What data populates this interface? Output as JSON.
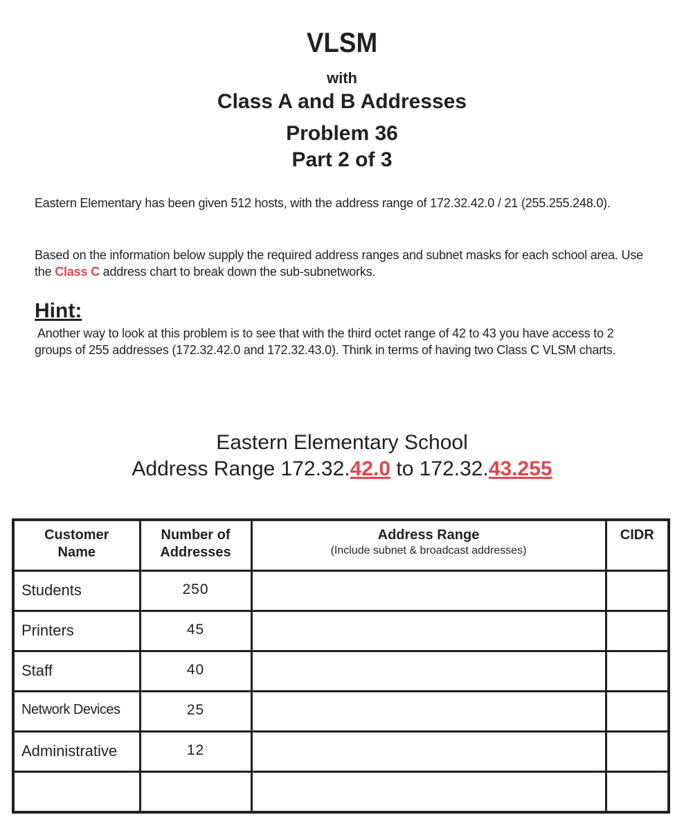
{
  "header": {
    "title": "VLSM",
    "with": "with",
    "subtitle": "Class A and B Addresses",
    "problem": "Problem 36",
    "part": "Part 2 of 3"
  },
  "intro": {
    "p1": "Eastern Elementary has been given 512 hosts, with the address range of 172.32.42.0 / 21 (255.255.248.0).",
    "p2_before": "Based on the information below supply the required address ranges and subnet masks for each school area.  Use the ",
    "p2_highlight": "Class C",
    "p2_after": " address chart to break down the sub-subnetworks.",
    "highlight_color": "#e1474d"
  },
  "hint": {
    "label": "Hint:",
    "text": "Another way to look at this problem is to see that with the third octet range of 42 to 43 you have access to 2 groups of 255 addresses (172.32.42.0 and 172.32.43.0).  Think in terms of having two Class C  VLSM charts."
  },
  "school": {
    "name": "Eastern Elementary School",
    "range_prefix": "Address Range 172.32.",
    "range_start": "42.0",
    "range_mid": " to 172.32.",
    "range_end": "43.255"
  },
  "table": {
    "headers": {
      "customer": "Customer Name",
      "number": "Number of Addresses",
      "range": "Address Range",
      "range_note": "(Include subnet & broadcast addresses)",
      "cidr": "CIDR"
    },
    "rows": [
      {
        "name": "Students",
        "count": "250",
        "range": "",
        "cidr": ""
      },
      {
        "name": "Printers",
        "count": "45",
        "range": "",
        "cidr": ""
      },
      {
        "name": "Staff",
        "count": "40",
        "range": "",
        "cidr": ""
      },
      {
        "name": "Network Devices",
        "count": "25",
        "range": "",
        "cidr": ""
      },
      {
        "name": "Administrative",
        "count": "12",
        "range": "",
        "cidr": ""
      },
      {
        "name": "",
        "count": "",
        "range": "",
        "cidr": ""
      }
    ]
  }
}
